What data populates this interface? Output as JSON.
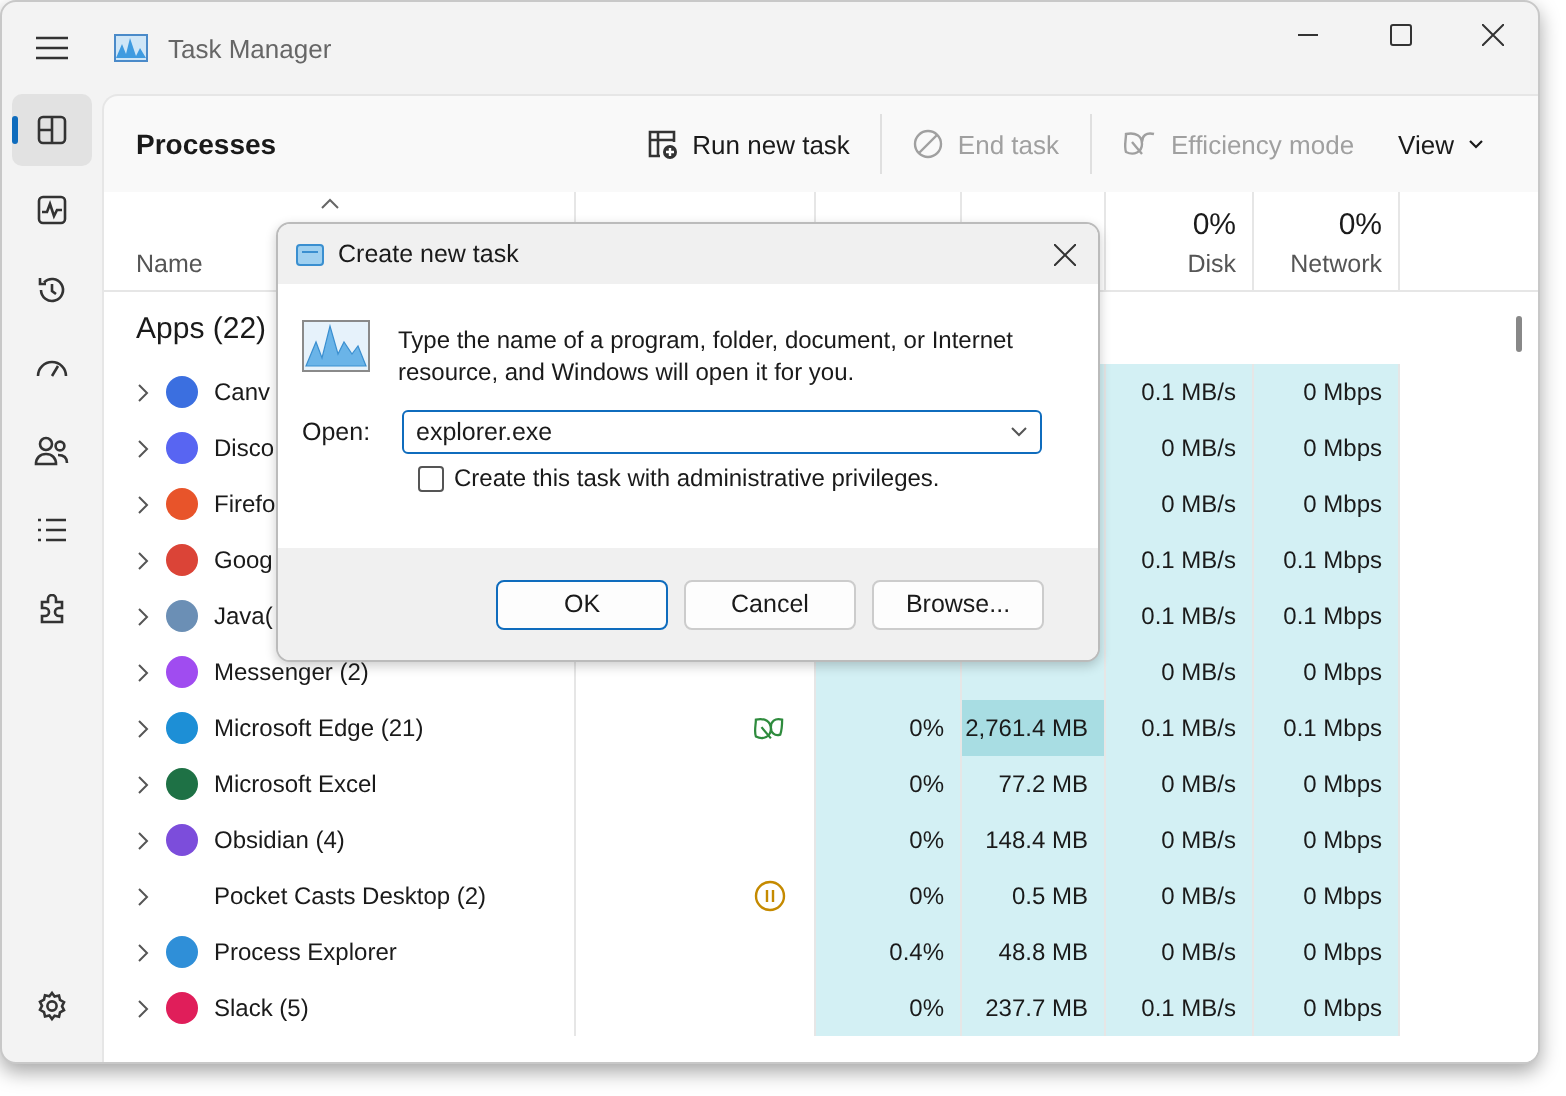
{
  "window": {
    "title": "Task Manager"
  },
  "nav": [
    {
      "kind": "processes",
      "selected": true
    },
    {
      "kind": "performance",
      "selected": false
    },
    {
      "kind": "history",
      "selected": false
    },
    {
      "kind": "startup",
      "selected": false
    },
    {
      "kind": "users",
      "selected": false
    },
    {
      "kind": "details",
      "selected": false
    },
    {
      "kind": "services",
      "selected": false
    }
  ],
  "page_title": "Processes",
  "toolbar": [
    {
      "kind": "run",
      "label": "Run new task",
      "disabled": false
    },
    {
      "kind": "end",
      "label": "End task",
      "disabled": true
    },
    {
      "kind": "efficiency",
      "label": "Efficiency mode",
      "disabled": true
    },
    {
      "kind": "menu",
      "label": "View",
      "disabled": false
    }
  ],
  "table": {
    "columns": [
      {
        "label": "Name"
      },
      {},
      {},
      {},
      {
        "label": "Disk",
        "value": "0%"
      },
      {
        "label": "Network",
        "value": "0%"
      }
    ],
    "group": "Apps (22)",
    "rows": [
      {
        "name": "Canv",
        "color": "#3b6fe0",
        "expanded": false,
        "efficiency_mode": false,
        "suspended": false,
        "cpu": null,
        "memory": null,
        "disk": "0.1 MB/s",
        "network": "0 Mbps",
        "highlight": false
      },
      {
        "name": "Disco",
        "color": "#5865f2",
        "expanded": false,
        "efficiency_mode": false,
        "suspended": false,
        "cpu": null,
        "memory": null,
        "disk": "0 MB/s",
        "network": "0 Mbps",
        "highlight": false
      },
      {
        "name": "Firefo",
        "color": "#e8542a",
        "expanded": false,
        "efficiency_mode": false,
        "suspended": false,
        "cpu": null,
        "memory": null,
        "disk": "0 MB/s",
        "network": "0 Mbps",
        "highlight": false
      },
      {
        "name": "Goog",
        "color": "#db4437",
        "expanded": false,
        "efficiency_mode": false,
        "suspended": false,
        "cpu": null,
        "memory": null,
        "disk": "0.1 MB/s",
        "network": "0.1 Mbps",
        "highlight": false
      },
      {
        "name": "Java(",
        "color": "#6b8fb5",
        "expanded": false,
        "efficiency_mode": false,
        "suspended": false,
        "cpu": null,
        "memory": null,
        "disk": "0.1 MB/s",
        "network": "0.1 Mbps",
        "highlight": false
      },
      {
        "name": "Messenger (2)",
        "color": "#a04cf0",
        "expanded": false,
        "efficiency_mode": false,
        "suspended": false,
        "cpu": null,
        "memory": null,
        "disk": "0 MB/s",
        "network": "0 Mbps",
        "highlight": false
      },
      {
        "name": "Microsoft Edge (21)",
        "color": "#1d8fd6",
        "expanded": false,
        "efficiency_mode": true,
        "suspended": false,
        "cpu": "0%",
        "memory": "2,761.4 MB",
        "disk": "0.1 MB/s",
        "network": "0.1 Mbps",
        "highlight": true
      },
      {
        "name": "Microsoft Excel",
        "color": "#1e7145",
        "expanded": false,
        "efficiency_mode": false,
        "suspended": false,
        "cpu": "0%",
        "memory": "77.2 MB",
        "disk": "0 MB/s",
        "network": "0 Mbps",
        "highlight": false
      },
      {
        "name": "Obsidian (4)",
        "color": "#7c4ddb",
        "expanded": false,
        "efficiency_mode": false,
        "suspended": false,
        "cpu": "0%",
        "memory": "148.4 MB",
        "disk": "0 MB/s",
        "network": "0 Mbps",
        "highlight": false
      },
      {
        "name": "Pocket Casts Desktop (2)",
        "expanded": false,
        "efficiency_mode": false,
        "suspended": true,
        "cpu": "0%",
        "memory": "0.5 MB",
        "disk": "0 MB/s",
        "network": "0 Mbps",
        "highlight": false
      },
      {
        "name": "Process Explorer",
        "color": "#2f8fd8",
        "expanded": false,
        "efficiency_mode": false,
        "suspended": false,
        "cpu": "0.4%",
        "memory": "48.8 MB",
        "disk": "0 MB/s",
        "network": "0 Mbps",
        "highlight": false
      },
      {
        "name": "Slack (5)",
        "color": "#e01e5a",
        "expanded": false,
        "efficiency_mode": false,
        "suspended": false,
        "cpu": "0%",
        "memory": "237.7 MB",
        "disk": "0.1 MB/s",
        "network": "0 Mbps",
        "highlight": false
      }
    ]
  },
  "dialog": {
    "title": "Create new task",
    "message": "Type the name of a program, folder, document, or Internet resource, and Windows will open it for you.",
    "open_label": "Open:",
    "open_value": "explorer.exe",
    "admin_label": "Create this task with administrative privileges.",
    "admin_checked": false,
    "buttons": [
      {
        "label": "OK",
        "default": true
      },
      {
        "label": "Cancel",
        "default": false
      },
      {
        "label": "Browse...",
        "default": false
      }
    ]
  }
}
